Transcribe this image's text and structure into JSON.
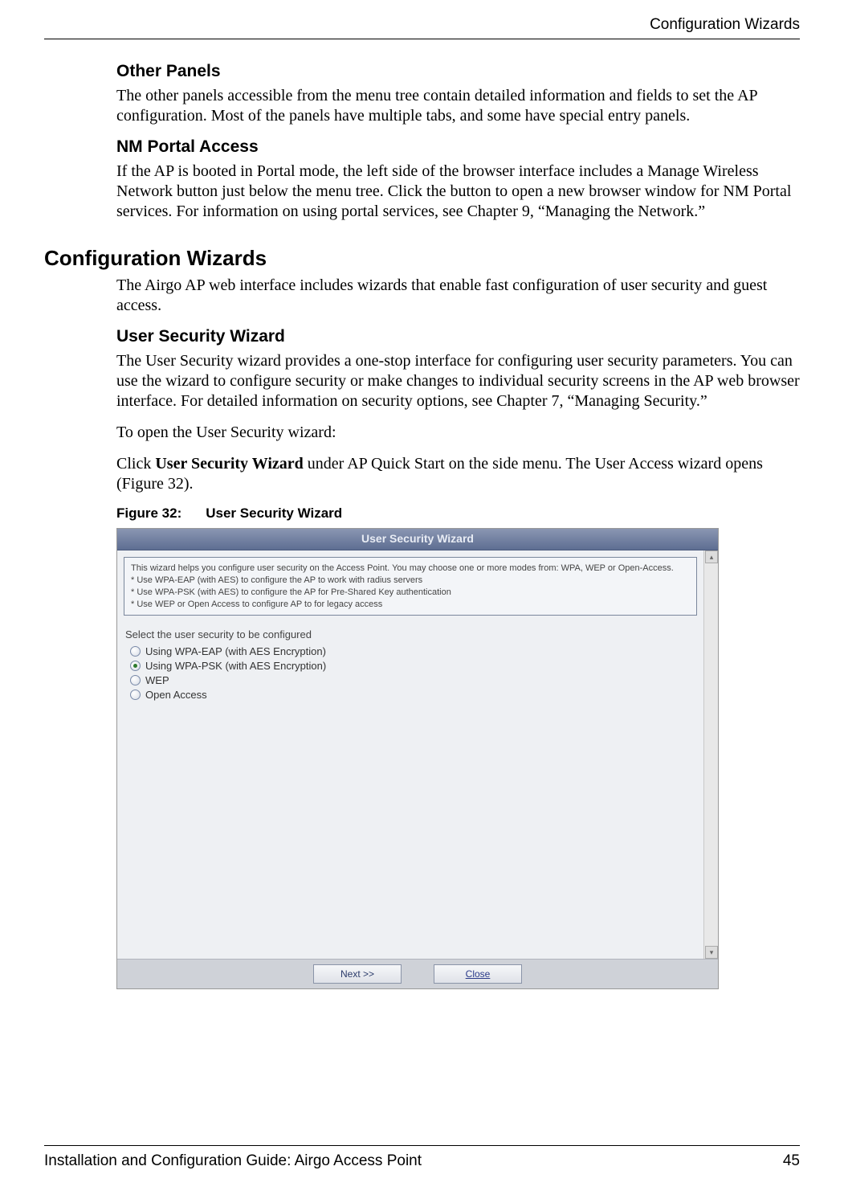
{
  "header": {
    "running": "Configuration Wizards"
  },
  "sections": {
    "other_panels": {
      "heading": "Other Panels",
      "p1": "The other panels accessible from the menu tree contain detailed information and fields to set the AP configuration. Most of the panels have multiple tabs, and some have special entry panels."
    },
    "nm_portal": {
      "heading": "NM Portal Access",
      "p1": "If the AP is booted in Portal mode, the left side of the browser interface includes a Manage Wireless Network button just below the menu tree. Click the button to open a new browser window for NM Portal services. For information on using portal services, see Chapter 9,  “Managing the Network.”"
    },
    "config_wizards": {
      "heading": "Configuration Wizards",
      "p1": "The Airgo AP web interface includes wizards that enable fast configuration of user security and guest access."
    },
    "user_security": {
      "heading": "User Security Wizard",
      "p1": "The User Security wizard provides a one-stop interface for configuring user security parameters. You can use the wizard to configure security or make changes to individual security screens in the AP web browser interface. For detailed information on security options, see Chapter 7,  “Managing Security.”",
      "p2": "To open the User Security wizard:",
      "p3_pre": "Click ",
      "p3_bold": "User Security Wizard",
      "p3_post": " under AP Quick Start on the side menu. The User Access wizard opens (Figure 32).",
      "figure_label": "Figure 32:",
      "figure_title": "User Security Wizard"
    }
  },
  "wizard": {
    "title": "User Security Wizard",
    "desc_line1": "This wizard helps you configure user security on the Access Point. You may choose one or more modes from: WPA, WEP or Open-Access.",
    "desc_b1": "* Use WPA-EAP (with AES) to configure the AP to work with radius servers",
    "desc_b2": "* Use WPA-PSK (with AES) to configure the AP for Pre-Shared Key authentication",
    "desc_b3": "* Use WEP or Open Access to configure AP to for legacy access",
    "select_label": "Select the user security to be configured",
    "options": {
      "o1": "Using WPA-EAP (with AES Encryption)",
      "o2": "Using WPA-PSK (with AES Encryption)",
      "o3": "WEP",
      "o4": "Open Access"
    },
    "next": "Next >>",
    "close": "Close"
  },
  "footer": {
    "left": "Installation and Configuration Guide: Airgo Access Point",
    "right": "45"
  }
}
